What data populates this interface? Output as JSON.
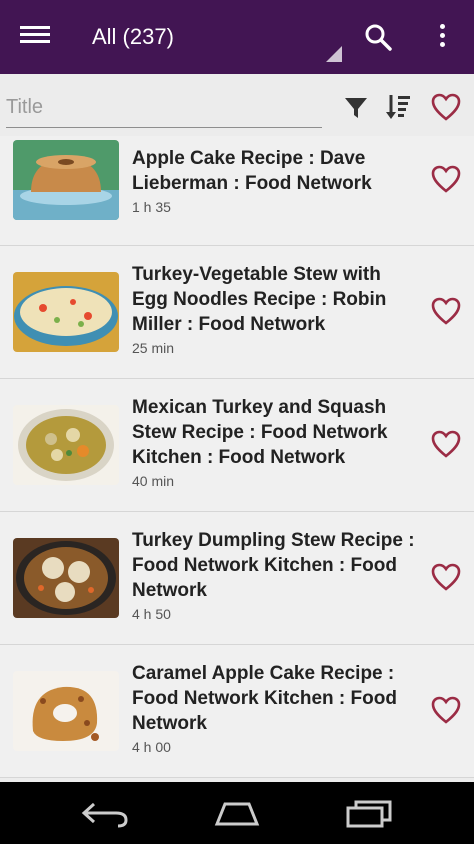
{
  "appbar": {
    "title": "All (237)",
    "icons": [
      "hamburger-menu-icon",
      "search-icon",
      "more-vert-icon"
    ]
  },
  "filter": {
    "placeholder": "Title",
    "icons": [
      "filter-icon",
      "sort-icon",
      "heart-outline-icon"
    ]
  },
  "recipes": [
    {
      "name": "Apple Cake Recipe : Dave Lieberman : Food Network",
      "time": "1 h 35"
    },
    {
      "name": "Turkey-Vegetable Stew with Egg Noodles Recipe : Robin Miller : Food Network",
      "time": "25 min"
    },
    {
      "name": "Mexican Turkey and Squash Stew Recipe : Food Network Kitchen : Food Network",
      "time": "40 min"
    },
    {
      "name": "Turkey Dumpling Stew Recipe : Food Network Kitchen : Food Network",
      "time": "4 h 50"
    },
    {
      "name": "Caramel Apple Cake Recipe : Food Network Kitchen : Food Network",
      "time": "4 h 00"
    }
  ],
  "navbar": {
    "icons": [
      "back-icon",
      "home-icon",
      "recent-apps-icon"
    ]
  },
  "colors": {
    "appbar": "#421553",
    "heart": "#9b2c45",
    "background": "#ececec"
  }
}
